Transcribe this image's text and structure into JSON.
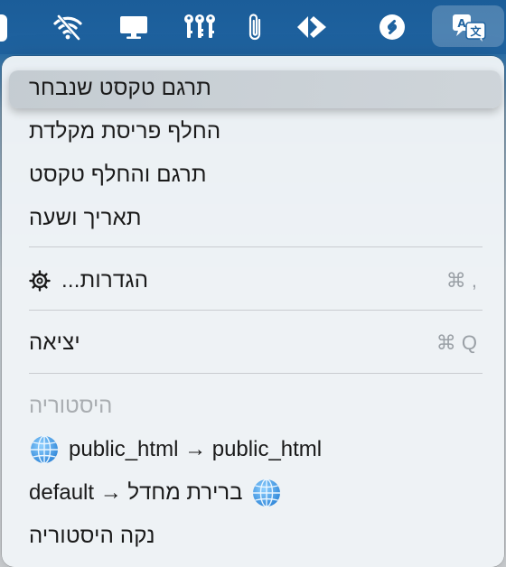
{
  "menubar": {
    "icons": [
      "app-stub-icon",
      "wifi-icon",
      "display-icon",
      "keys-icon",
      "paperclip-icon",
      "diamond-arrows-icon",
      "shazam-icon",
      "translate-icon"
    ]
  },
  "menu": {
    "items": [
      {
        "label": "תרגם טקסט שנבחר",
        "highlighted": true
      },
      {
        "label": "החלף פריסת מקלדת"
      },
      {
        "label": "תרגם והחלף טקסט"
      },
      {
        "label": "תאריך ושעה"
      }
    ],
    "settings": {
      "label": "הגדרות...",
      "shortcut": "⌘ ,"
    },
    "quit": {
      "label": "יציאה",
      "shortcut": "⌘ Q"
    },
    "history": {
      "header": "היסטוריה",
      "entries": [
        {
          "text": "public_html → public_html"
        },
        {
          "text": "default → ברירת מחדל"
        }
      ],
      "clear": "נקה היסטוריה"
    }
  }
}
